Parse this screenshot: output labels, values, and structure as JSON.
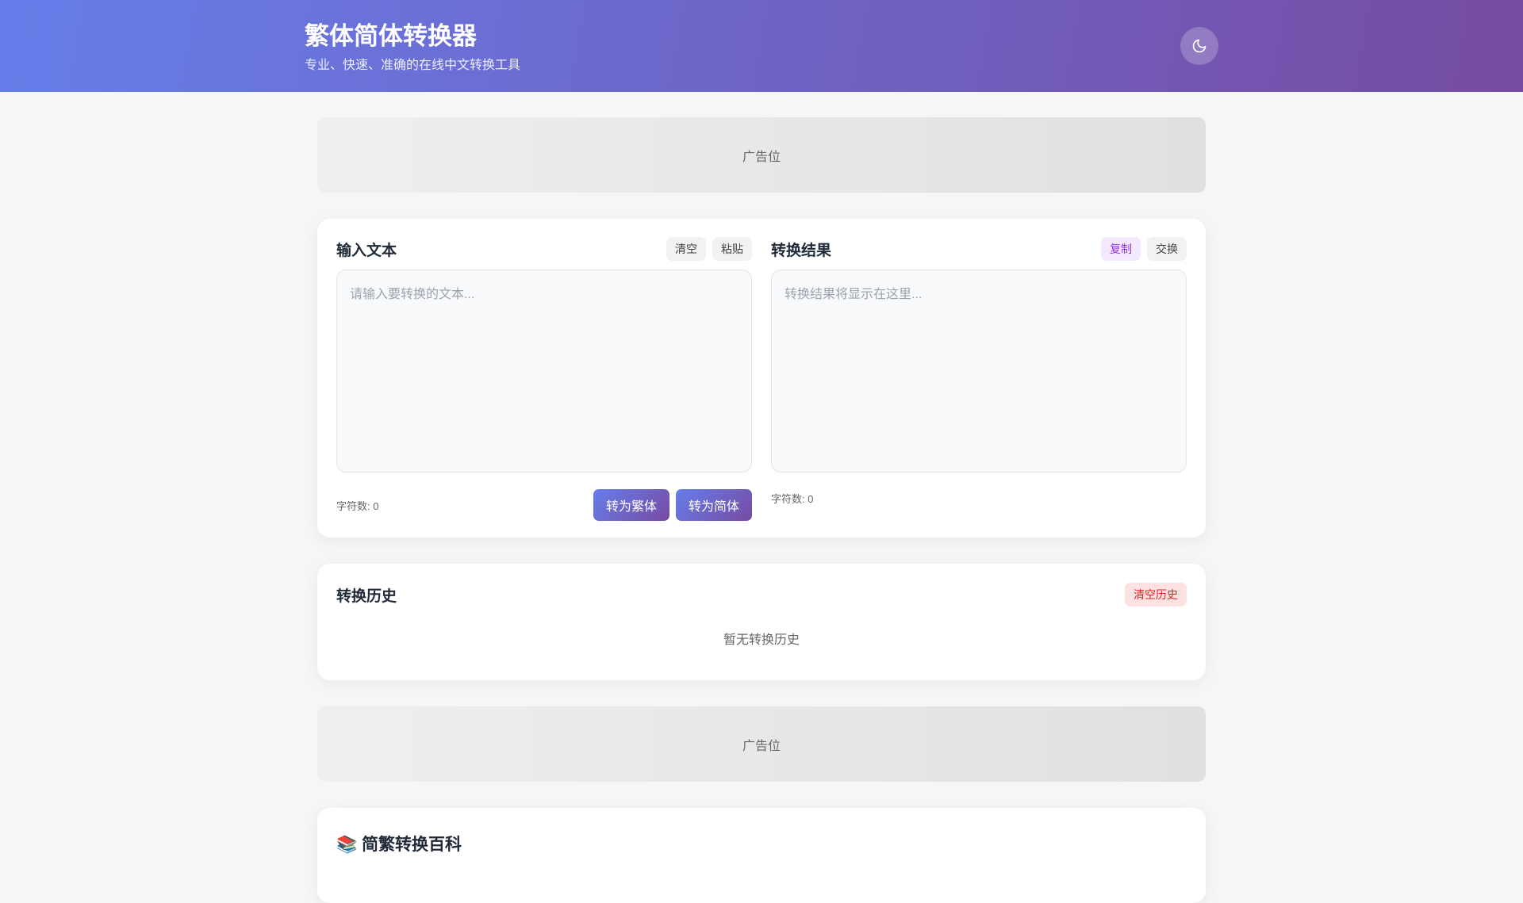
{
  "header": {
    "title": "繁体简体转换器",
    "subtitle": "专业、快速、准确的在线中文转换工具",
    "theme_icon": "moon-icon"
  },
  "ads": {
    "top": "广告位",
    "bottom": "广告位"
  },
  "input": {
    "title": "输入文本",
    "clear": "清空",
    "paste": "粘贴",
    "placeholder": "请输入要转换的文本...",
    "count": "字符数: 0",
    "to_traditional": "转为繁体",
    "to_simplified": "转为简体"
  },
  "output": {
    "title": "转换结果",
    "copy": "复制",
    "swap": "交换",
    "placeholder": "转换结果将显示在这里...",
    "count": "字符数: 0"
  },
  "history": {
    "title": "转换历史",
    "clear": "清空历史",
    "empty": "暂无转换历史"
  },
  "wiki": {
    "icon": "📚",
    "title": "简繁转换百科"
  }
}
